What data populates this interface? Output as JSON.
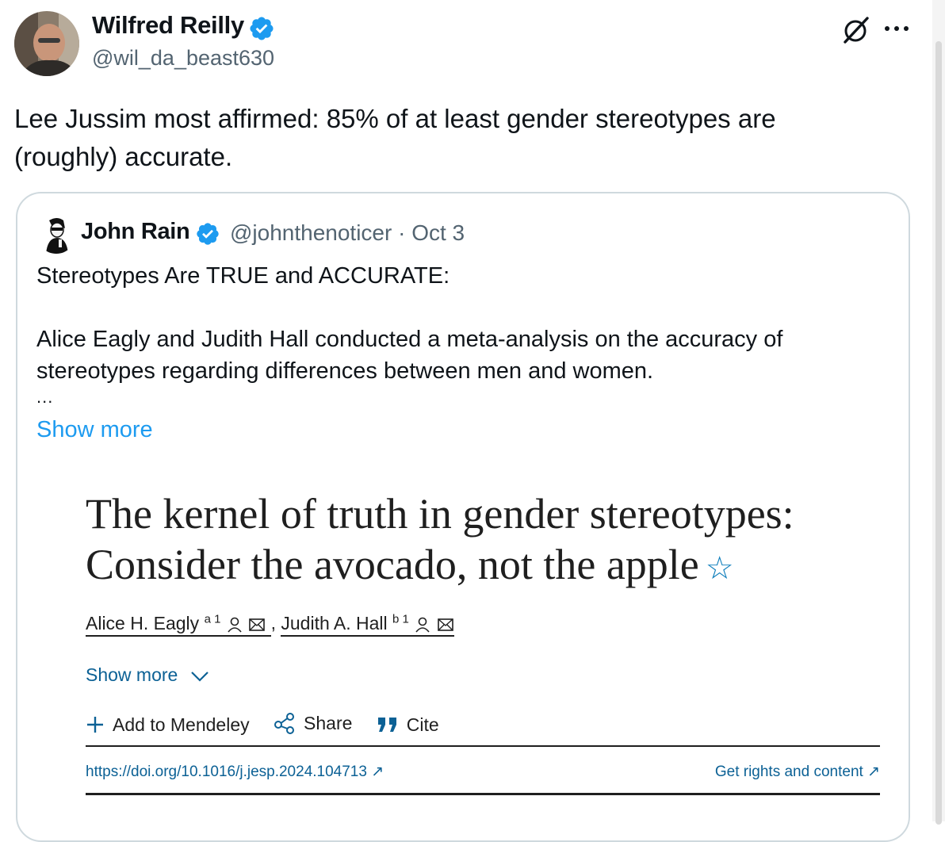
{
  "tweet": {
    "author_name": "Wilfred Reilly",
    "handle": "@wil_da_beast630",
    "text_line1": "Lee Jussim most affirmed: 85% of at least gender stereotypes are",
    "text_line2": "(roughly) accurate."
  },
  "quoted": {
    "author_name": "John Rain",
    "meta": "@johnthenoticer · Oct 3",
    "line1": "Stereotypes Are TRUE and ACCURATE:",
    "line2": "Alice Eagly and Judith Hall conducted a meta-analysis on the accuracy of",
    "line3": "stereotypes regarding differences between men and women.",
    "ellipsis": "...",
    "show_more": "Show more"
  },
  "article": {
    "title_line1": "The kernel of truth in gender stereotypes:",
    "title_line2": "Consider the avocado, not the apple",
    "star": "☆",
    "author1": "Alice H. Eagly",
    "author1_sup": "a 1",
    "separator": ",",
    "author2": "Judith A. Hall",
    "author2_sup": "b 1",
    "show_more": "Show more",
    "add_mendeley": "Add to Mendeley",
    "share": "Share",
    "cite": "Cite",
    "doi": "https://doi.org/10.1016/j.jesp.2024.104713 ↗",
    "rights": "Get rights and content ↗"
  },
  "colors": {
    "verified": "#1d9bf0",
    "link": "#1d9bf0",
    "secondary_text": "#536471",
    "article_link": "#0c6195",
    "border": "#cfd9de"
  }
}
